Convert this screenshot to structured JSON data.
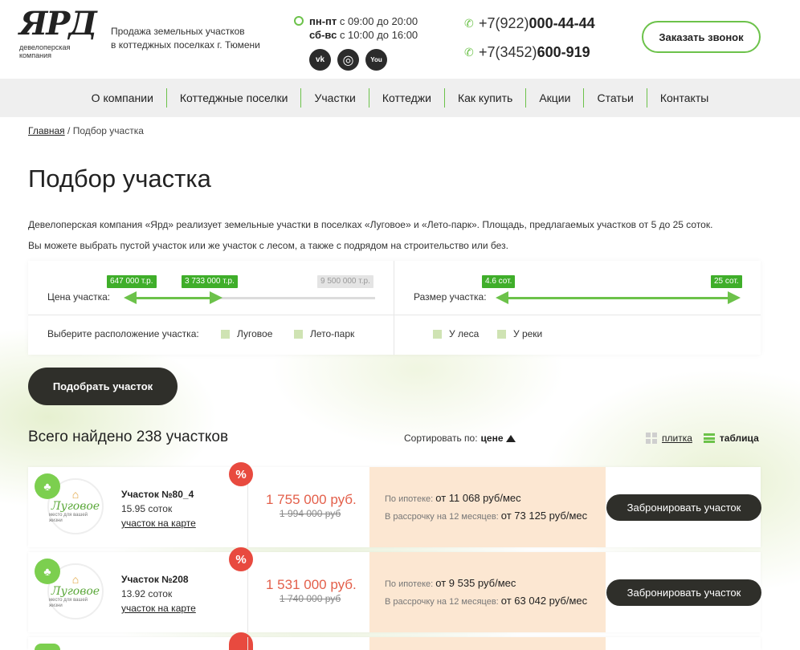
{
  "header": {
    "logo": {
      "mark": "ЯРД",
      "sub_line1": "девелоперская",
      "sub_line2": "компания"
    },
    "tagline_line1": "Продажа земельных участков",
    "tagline_line2": "в коттеджных поселках г. Тюмени",
    "hours": [
      {
        "days": "пн-пт",
        "time": " с 09:00 до 20:00"
      },
      {
        "days": "сб-вс",
        "time": " с 10:00 до 16:00"
      }
    ],
    "socials": [
      {
        "name": "vk-icon",
        "glyph": "vk"
      },
      {
        "name": "instagram-icon",
        "glyph": "◎"
      },
      {
        "name": "youtube-icon",
        "glyph": "You"
      }
    ],
    "phones": [
      {
        "prefix": "+7(922)",
        "number": "000-44-44"
      },
      {
        "prefix": "+7(3452)",
        "number": "600-919"
      }
    ],
    "callback_label": "Заказать звонок"
  },
  "nav": [
    "О компании",
    "Коттеджные поселки",
    "Участки",
    "Коттеджи",
    "Как купить",
    "Акции",
    "Статьи",
    "Контакты"
  ],
  "breadcrumb": {
    "home": "Главная",
    "sep": " / ",
    "current": "Подбор участка"
  },
  "page_title": "Подбор участка",
  "intro": [
    "Девелоперская компания «Ярд» реализует земельные участки в поселках «Луговое» и «Лето-парк». Площадь, предлагаемых участков от 5 до 25 соток.",
    "Вы можете выбрать пустой участок или же участок с лесом, а также с подрядом на строительство или без."
  ],
  "filter": {
    "price_label": "Цена участка:",
    "price_min": "647 000 т.р.",
    "price_sel": "3 733 000 т.р.",
    "price_max": "9 500 000 т.р.",
    "price_range_fraction": [
      0,
      0.35
    ],
    "size_label": "Размер участка:",
    "size_min": "4.6 сот.",
    "size_max": "25 сот.",
    "location_label": "Выберите расположение участка:",
    "locations": [
      "Луговое",
      "Лето-парк"
    ],
    "features": [
      "У леса",
      "У реки"
    ],
    "check_color": "#cfe3b3"
  },
  "pick_button": "Подобрать участок",
  "results": {
    "found_text": "Всего найдено 238 участков",
    "sort_label": "Сортировать по:",
    "sort_value": "цене",
    "view_tile": "плитка",
    "view_table": "таблица"
  },
  "lots": [
    {
      "title": "Участок №80_4",
      "size": "15.95 соток",
      "map_link": "участок на карте",
      "village": "Луговое",
      "village_sub": "место для вашей жизни",
      "price": "1 755 000 руб.",
      "old_price": "1 994 000 руб",
      "mortgage_label": "По ипотеке: ",
      "mortgage": "от 11 068 руб/мес",
      "installment_label": "В рассрочку на 12 месяцев: ",
      "installment": "от 73 125 руб/мес",
      "book_label": "Забронировать участок"
    },
    {
      "title": "Участок №208",
      "size": "13.92 соток",
      "map_link": "участок на карте",
      "village": "Луговое",
      "village_sub": "место для вашей жизни",
      "price": "1 531 000 руб.",
      "old_price": "1 740 000 руб",
      "mortgage_label": "По ипотеке: ",
      "mortgage": "от 9 535 руб/мес",
      "installment_label": "В рассрочку на 12 месяцев: ",
      "installment": "от 63 042 руб/мес",
      "book_label": "Забронировать участок"
    }
  ],
  "colors": {
    "accent": "#6cc24a",
    "discount": "#e84a3f",
    "price": "#e35f4a",
    "dark_button": "#2f2f2a",
    "payment_bg": "#fce7d2"
  }
}
